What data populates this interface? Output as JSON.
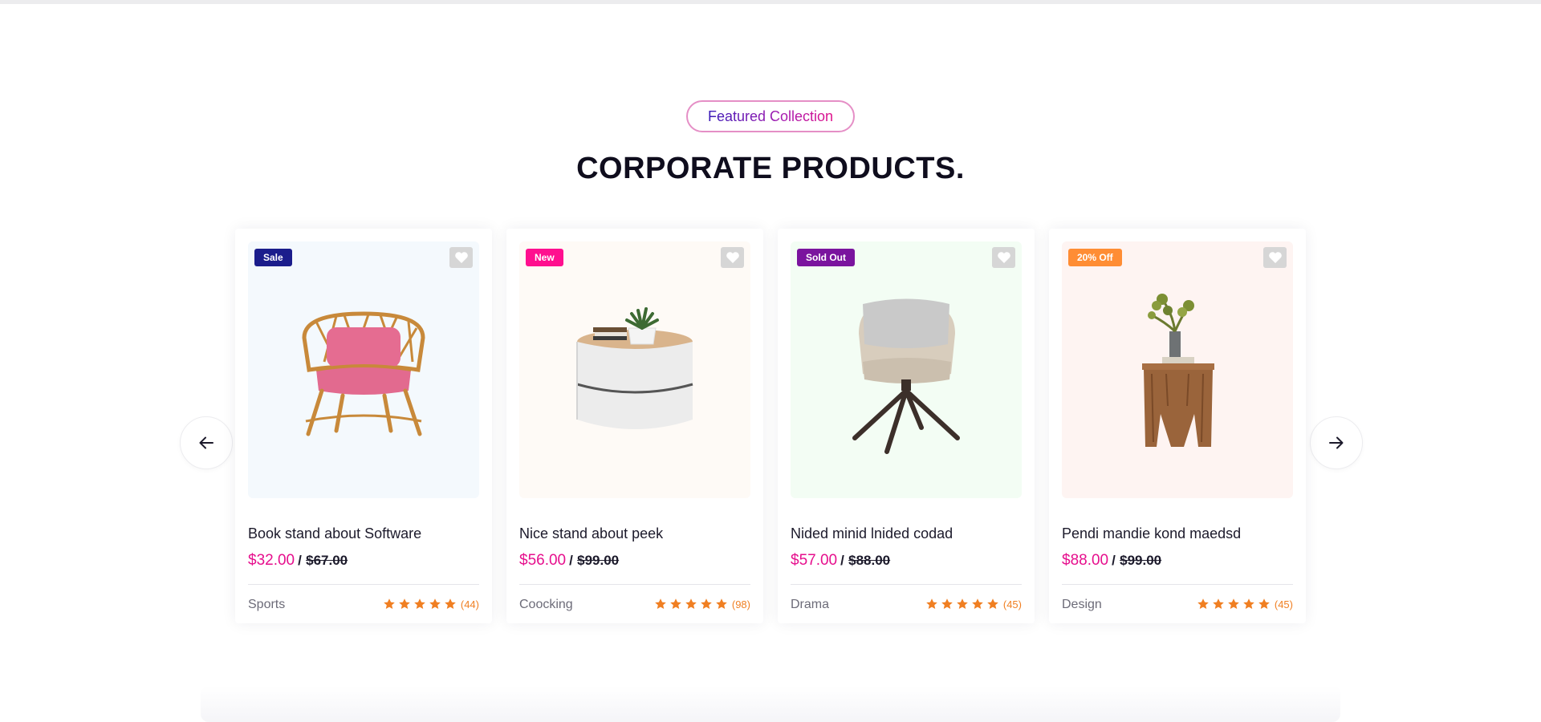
{
  "section": {
    "eyebrow": "Featured Collection",
    "title": "CORPORATE PRODUCTS."
  },
  "nav": {
    "prev_icon": "arrow-left-icon",
    "next_icon": "arrow-right-icon"
  },
  "products": [
    {
      "badge": "Sale",
      "badge_color": "#1b1d8c",
      "media_bg": "#f4f9fd",
      "image": "rattan-armchair",
      "name": "Book stand about Software",
      "price": "$32.00",
      "separator": "/",
      "old_price": "$67.00",
      "category": "Sports",
      "rating": 5,
      "reviews": "(44)"
    },
    {
      "badge": "New",
      "badge_color": "#ff0f8f",
      "media_bg": "#fefaf6",
      "image": "round-side-table",
      "name": "Nice stand about peek",
      "price": "$56.00",
      "separator": "/",
      "old_price": "$99.00",
      "category": "Coocking",
      "rating": 5,
      "reviews": "(98)"
    },
    {
      "badge": "Sold Out",
      "badge_color": "#7a149e",
      "media_bg": "#f3fdf4",
      "image": "upholstered-chair",
      "name": "Nided minid lnided codad",
      "price": "$57.00",
      "separator": "/",
      "old_price": "$88.00",
      "category": "Drama",
      "rating": 5,
      "reviews": "(45)"
    },
    {
      "badge": "20% Off",
      "badge_color": "#ff8d34",
      "media_bg": "#fef4f2",
      "image": "wooden-stool-with-vase",
      "name": "Pendi mandie kond maedsd",
      "price": "$88.00",
      "separator": "/",
      "old_price": "$99.00",
      "category": "Design",
      "rating": 5,
      "reviews": "(45)"
    }
  ],
  "colors": {
    "accent_price": "#e60f8d",
    "star": "#f07f22"
  }
}
